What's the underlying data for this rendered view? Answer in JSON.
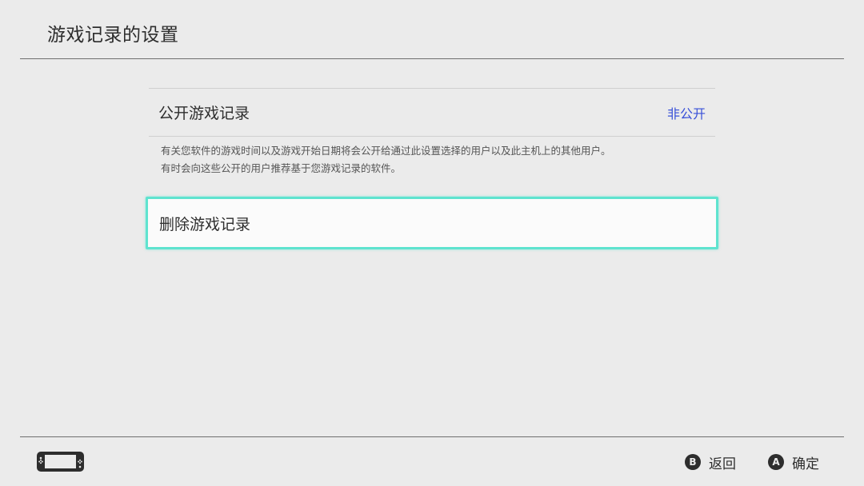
{
  "header": {
    "title": "游戏记录的设置"
  },
  "settings": {
    "public_record": {
      "label": "公开游戏记录",
      "value": "非公开",
      "description_line1": "有关您软件的游戏时间以及游戏开始日期将会公开给通过此设置选择的用户以及此主机上的其他用户。",
      "description_line2": "有时会向这些公开的用户推荐基于您游戏记录的软件。"
    },
    "delete_record": {
      "label": "删除游戏记录",
      "selected": true
    }
  },
  "footer": {
    "console_icon": "switch-console-icon",
    "back": {
      "button": "B",
      "label": "返回"
    },
    "confirm": {
      "button": "A",
      "label": "确定"
    }
  },
  "colors": {
    "background": "#ebebeb",
    "accent_value": "#3850d8",
    "selection_border": "#5fe3cf",
    "text": "#2d2d2d"
  }
}
